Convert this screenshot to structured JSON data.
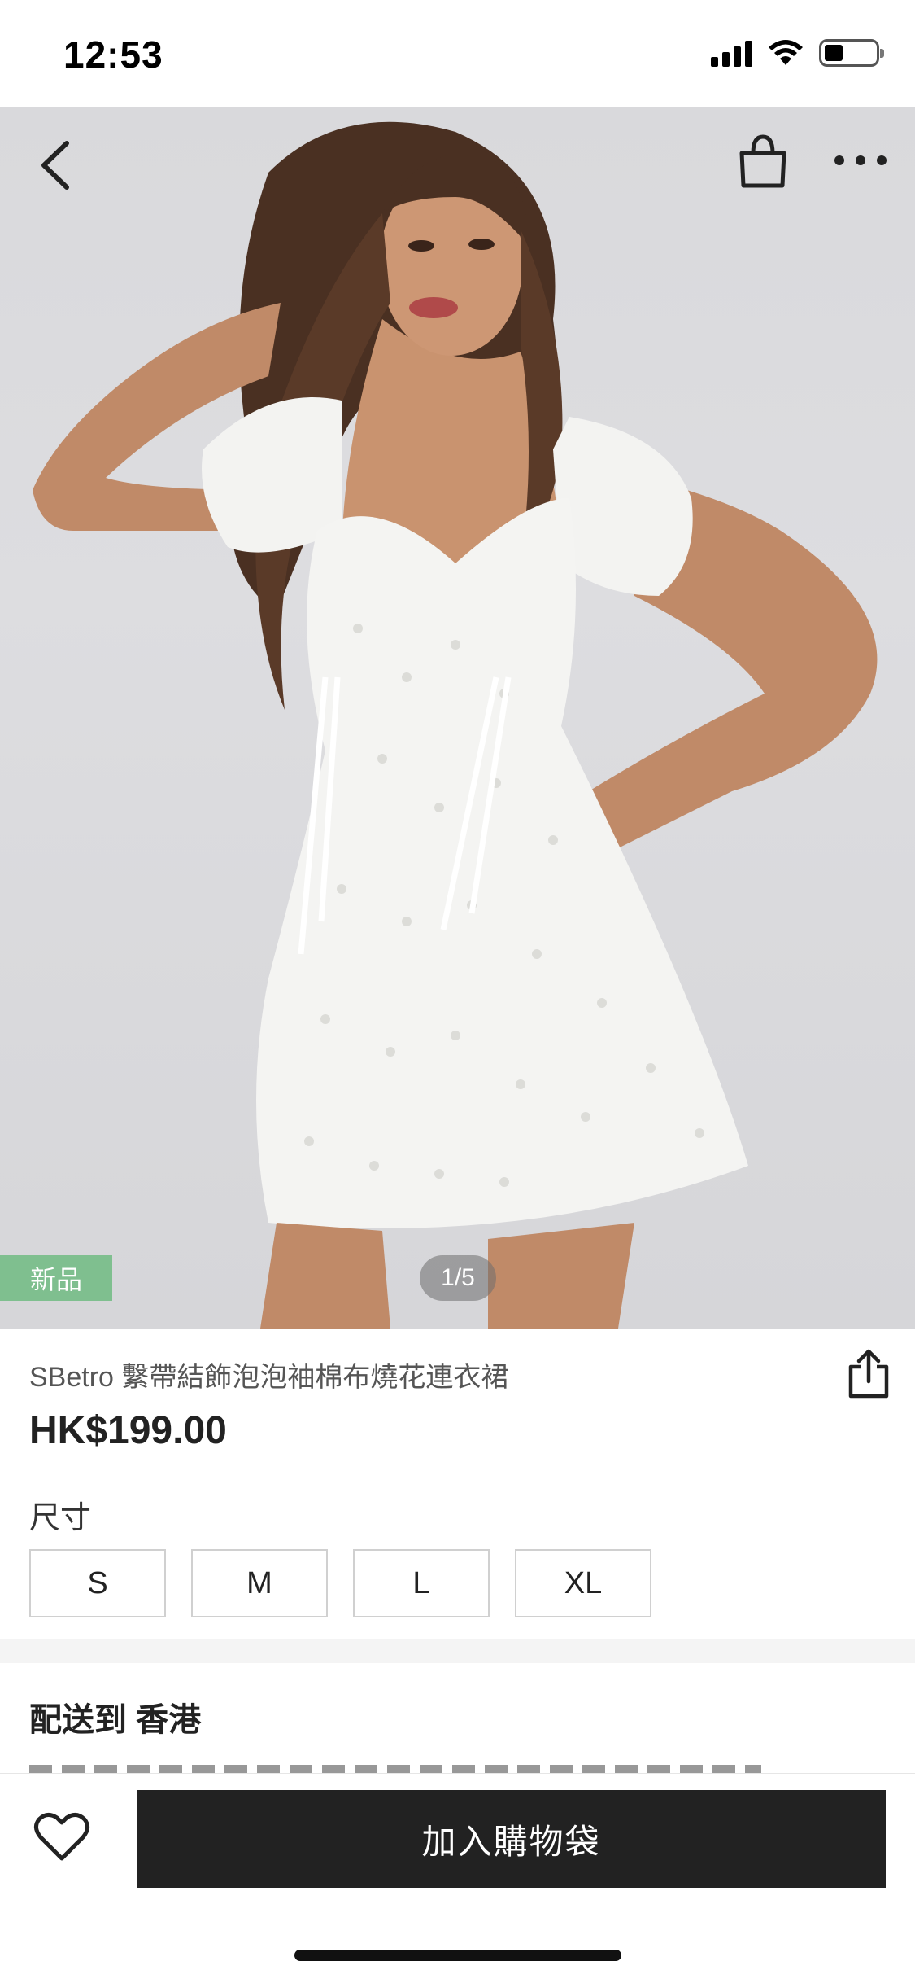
{
  "status_bar": {
    "time": "12:53",
    "icons": [
      "cellular-signal-icon",
      "wifi-icon",
      "battery-icon"
    ]
  },
  "hero": {
    "badge": "新品",
    "page_indicator": "1/5",
    "nav_icons": [
      "back-chevron-icon",
      "shopping-bag-icon",
      "more-dots-icon"
    ]
  },
  "product": {
    "title": "SBetro 繫帶結飾泡泡袖棉布燒花連衣裙",
    "price": "HK$199.00",
    "size_label": "尺寸",
    "sizes": [
      "S",
      "M",
      "L",
      "XL"
    ],
    "share_icon": "share-icon"
  },
  "shipping": {
    "label": "配送到 香港"
  },
  "bottom_bar": {
    "wishlist_icon": "heart-icon",
    "add_to_bag": "加入購物袋"
  },
  "colors": {
    "badge_green": "#7fbf8f",
    "button_dark": "#222222",
    "photo_background": "#dcdcdf",
    "dress_white": "#f4f4f2"
  }
}
